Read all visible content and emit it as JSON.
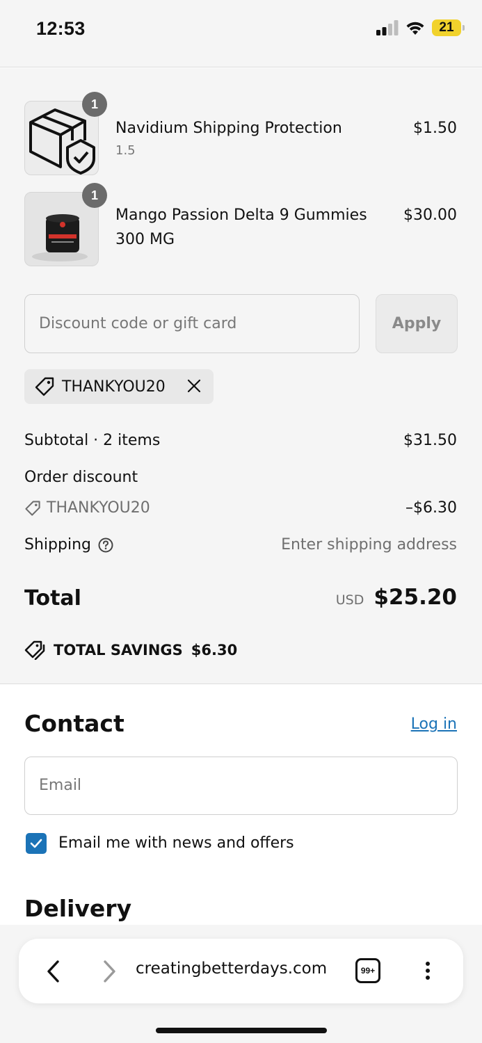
{
  "status": {
    "time": "12:53",
    "battery": "21"
  },
  "cart": {
    "items": [
      {
        "name": "Navidium Shipping Protection",
        "variant": "1.5",
        "price": "$1.50",
        "quantity": "1"
      },
      {
        "name": "Mango Passion Delta 9 Gummies 300 MG",
        "price": "$30.00",
        "quantity": "1"
      }
    ]
  },
  "discount": {
    "placeholder": "Discount code or gift card",
    "apply_label": "Apply",
    "applied_code": "THANKYOU20"
  },
  "summary": {
    "subtotal_label": "Subtotal · 2 items",
    "subtotal_value": "$31.50",
    "order_discount_label": "Order discount",
    "discount_code": "THANKYOU20",
    "discount_value": "–$6.30",
    "shipping_label": "Shipping",
    "shipping_value": "Enter shipping address",
    "total_label": "Total",
    "currency": "USD",
    "total_value": "$25.20",
    "savings_label": "TOTAL SAVINGS",
    "savings_value": "$6.30"
  },
  "contact": {
    "title": "Contact",
    "login_label": "Log in",
    "email_placeholder": "Email",
    "newsletter_label": "Email me with news and offers",
    "newsletter_checked": true
  },
  "delivery": {
    "title": "Delivery"
  },
  "browser": {
    "url": "creatingbetterdays.com",
    "tab_count": "99+"
  },
  "colors": {
    "accent": "#1b73b7",
    "summary_bg": "#f5f5f5"
  }
}
